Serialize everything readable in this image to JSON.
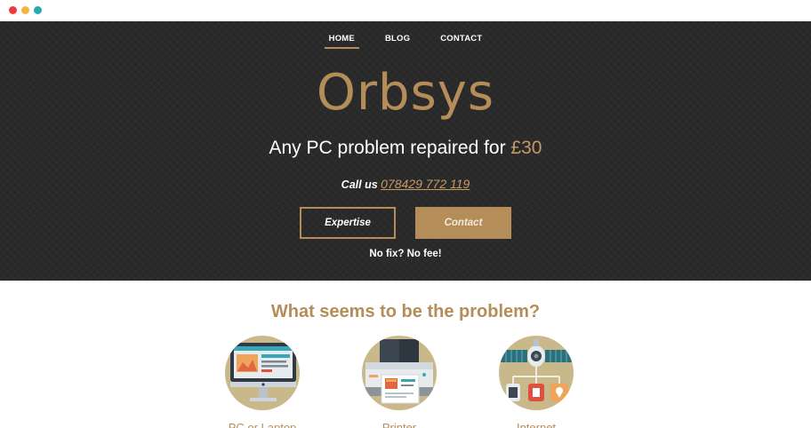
{
  "nav": {
    "items": [
      {
        "label": "HOME",
        "active": true
      },
      {
        "label": "BLOG",
        "active": false
      },
      {
        "label": "CONTACT",
        "active": false
      }
    ]
  },
  "hero": {
    "brand": "Orbsys",
    "tagline_prefix": "Any PC problem repaired for ",
    "tagline_price": "£30",
    "call_prefix": "Call us ",
    "phone": "078429 772 119",
    "expertise_label": "Expertise",
    "contact_label": "Contact",
    "guarantee": "No fix? No fee!"
  },
  "problems": {
    "heading": "What seems to be the problem?",
    "items": [
      {
        "label": "PC or Laptop",
        "icon": "computer-monitor-icon"
      },
      {
        "label": "Printer",
        "icon": "printer-icon"
      },
      {
        "label": "Internet",
        "icon": "satellite-icon"
      }
    ]
  },
  "colors": {
    "accent": "#b48d58",
    "hero_bg": "#2a2a2a",
    "icon_circle": "#c9b88a"
  }
}
